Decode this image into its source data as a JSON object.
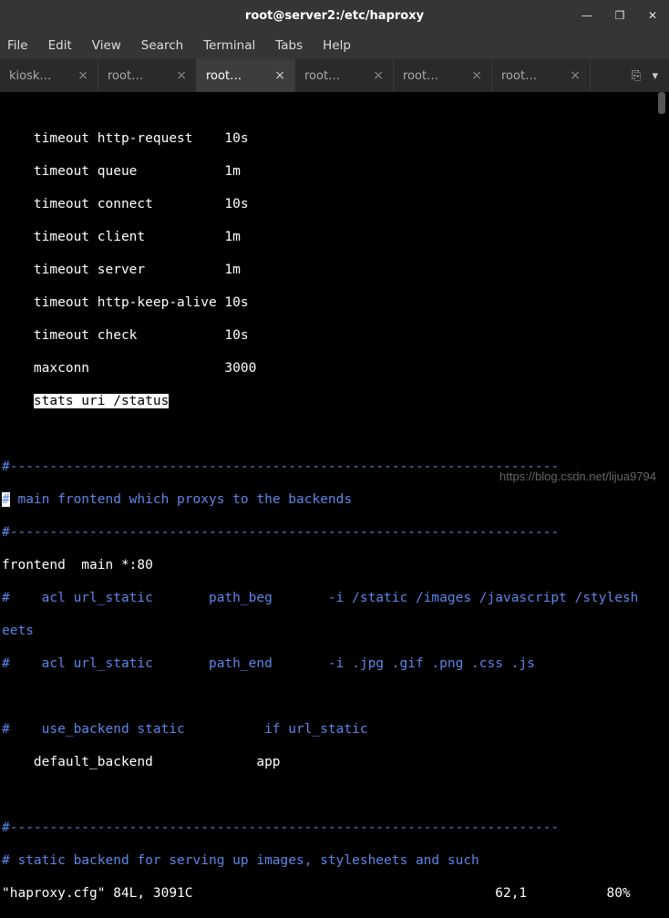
{
  "window": {
    "title": "root@server2:/etc/haproxy",
    "controls": {
      "min": "—",
      "max": "❐",
      "close": "✕"
    }
  },
  "menu": {
    "file": "File",
    "edit": "Edit",
    "view": "View",
    "search": "Search",
    "terminal": "Terminal",
    "tabs": "Tabs",
    "help": "Help"
  },
  "tabs": {
    "items": [
      {
        "label": "kiosk…",
        "active": false
      },
      {
        "label": "root…",
        "active": false
      },
      {
        "label": "root…",
        "active": true
      },
      {
        "label": "root…",
        "active": false
      },
      {
        "label": "root…",
        "active": false
      },
      {
        "label": "root…",
        "active": false
      }
    ],
    "close_glyph": "×",
    "dropdown_glyph": "▾",
    "overflow_glyph": "⎘"
  },
  "term": {
    "l0": "    timeout http-request    10s",
    "l1": "    timeout queue           1m",
    "l2": "    timeout connect         10s",
    "l3": "    timeout client          1m",
    "l4": "    timeout server          1m",
    "l5": "    timeout http-keep-alive 10s",
    "l6": "    timeout check           10s",
    "l7": "    maxconn                 3000",
    "l8_a": "    ",
    "l8_hl": "stats uri /status",
    "sep": "#---------------------------------------------------------------------",
    "c1_pre": "#",
    "c1_rest": " main frontend which proxys to the backends",
    "fe": "frontend  main *:80",
    "c2": "#    acl url_static       path_beg       -i /static /images /javascript /stylesh",
    "c2b": "eets",
    "c3": "#    acl url_static       path_end       -i .jpg .gif .png .css .js",
    "c4": "#    use_backend static          if url_static",
    "db": "    default_backend             app",
    "c5": "# static backend for serving up images, stylesheets and such",
    "status": "\"haproxy.cfg\" 84L, 3091C                                      62,1          80%"
  },
  "watermark": "https://blog.csdn.net/lijua9794"
}
